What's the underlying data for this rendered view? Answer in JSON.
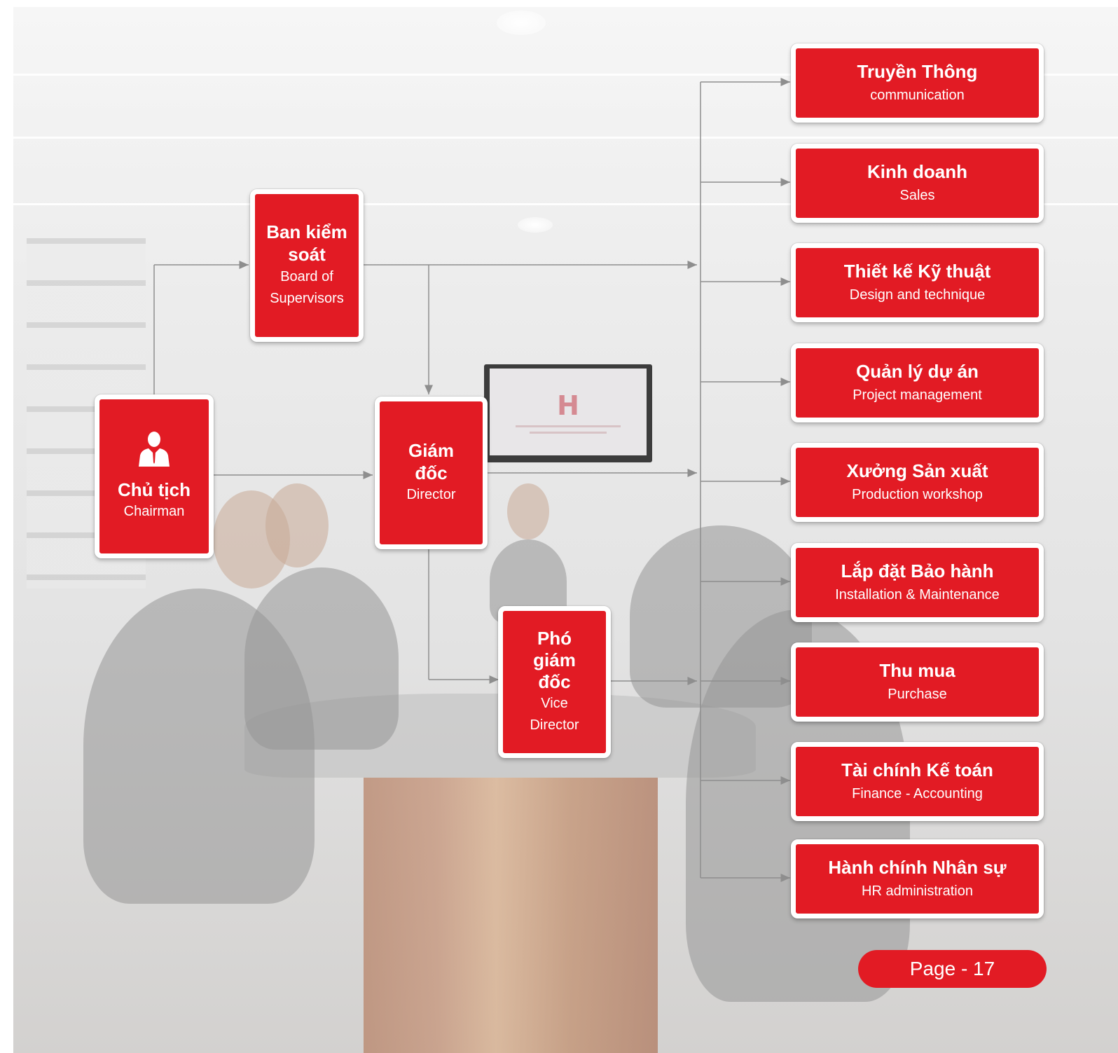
{
  "colors": {
    "node_red": "#e21b24",
    "node_border": "#ffffff",
    "connector": "#8e8e8e"
  },
  "nodes": {
    "chairman": {
      "title": "Chủ tịch",
      "subtitle": "Chairman",
      "icon": "person-icon"
    },
    "supervisors": {
      "title": "Ban kiểm soát",
      "subtitle": "Board of Supervisors"
    },
    "director": {
      "title": "Giám đốc",
      "subtitle": "Director"
    },
    "vice_director": {
      "title": "Phó giám đốc",
      "subtitle": "Vice Director"
    }
  },
  "departments": [
    {
      "title": "Truyền Thông",
      "subtitle": "communication"
    },
    {
      "title": "Kinh doanh",
      "subtitle": "Sales"
    },
    {
      "title": "Thiết kế Kỹ thuật",
      "subtitle": "Design and technique"
    },
    {
      "title": "Quản lý dự án",
      "subtitle": "Project management"
    },
    {
      "title": "Xưởng Sản xuất",
      "subtitle": "Production workshop"
    },
    {
      "title": "Lắp đặt Bảo hành",
      "subtitle": "Installation & Maintenance"
    },
    {
      "title": "Thu mua",
      "subtitle": "Purchase"
    },
    {
      "title": "Tài chính Kế toán",
      "subtitle": "Finance - Accounting"
    },
    {
      "title": "Hành chính Nhân sự",
      "subtitle": "HR administration"
    }
  ],
  "footer": {
    "page_label": "Page - 17"
  }
}
